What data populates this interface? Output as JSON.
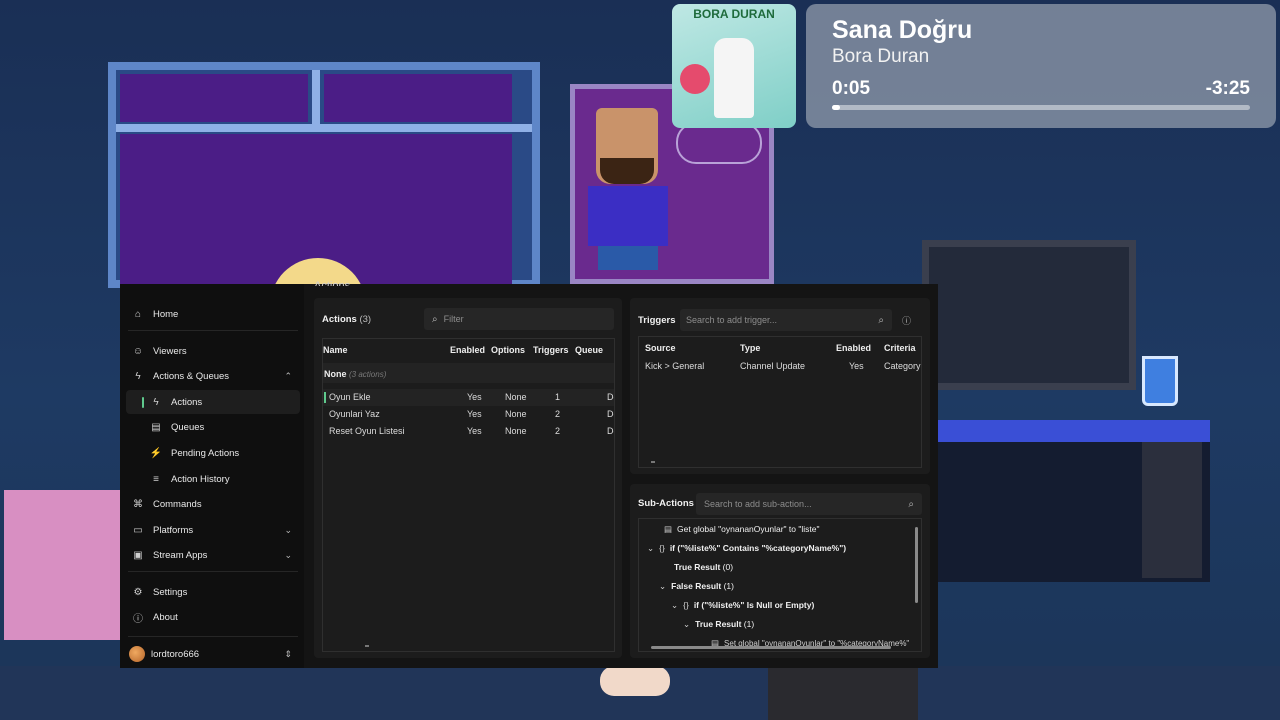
{
  "now_playing": {
    "title": "Sana Doğru",
    "artist": "Bora Duran",
    "elapsed": "0:05",
    "remaining": "-3:25",
    "progress_fraction": 0.02,
    "album_art_text": "BORA DURAN"
  },
  "app": {
    "hidden_header": "Actions",
    "sidebar": {
      "items": [
        {
          "label": "Home",
          "icon": "home-icon"
        },
        {
          "label": "Viewers",
          "icon": "users-icon"
        },
        {
          "label": "Actions & Queues",
          "icon": "bolt-icon"
        },
        {
          "label": "Actions",
          "icon": "bolt-icon"
        },
        {
          "label": "Queues",
          "icon": "queue-icon"
        },
        {
          "label": "Pending Actions",
          "icon": "pending-icon"
        },
        {
          "label": "Action History",
          "icon": "history-icon"
        },
        {
          "label": "Commands",
          "icon": "command-icon"
        },
        {
          "label": "Platforms",
          "icon": "platforms-icon"
        },
        {
          "label": "Stream Apps",
          "icon": "apps-icon"
        },
        {
          "label": "Settings",
          "icon": "gear-icon"
        },
        {
          "label": "About",
          "icon": "info-icon"
        }
      ],
      "user": "lordtoro666"
    },
    "actions": {
      "title": "Actions",
      "count": "(3)",
      "filter_placeholder": "Filter",
      "columns": [
        "Name",
        "Enabled",
        "Options",
        "Triggers",
        "Queue"
      ],
      "group": {
        "label": "None",
        "count": "(3 actions)"
      },
      "rows": [
        {
          "name": "Oyun Ekle",
          "enabled": "Yes",
          "options": "None",
          "triggers": "1",
          "queue": "De"
        },
        {
          "name": "Oyunlari Yaz",
          "enabled": "Yes",
          "options": "None",
          "triggers": "2",
          "queue": "De"
        },
        {
          "name": "Reset Oyun Listesi",
          "enabled": "Yes",
          "options": "None",
          "triggers": "2",
          "queue": "De"
        }
      ]
    },
    "triggers": {
      "title": "Triggers",
      "search_placeholder": "Search to add trigger...",
      "columns": [
        "Source",
        "Type",
        "Enabled",
        "Criteria"
      ],
      "rows": [
        {
          "source": "Kick > General",
          "type": "Channel Update",
          "enabled": "Yes",
          "criteria": "Category"
        }
      ]
    },
    "subactions": {
      "title": "Sub-Actions",
      "search_placeholder": "Search to add sub-action...",
      "lines": [
        "Get global \"oynananOyunlar\" to \"liste\"",
        "if (\"%liste%\" Contains \"%categoryName%\")",
        "True Result",
        "(0)",
        "False Result",
        "(1)",
        "if (\"%liste%\" Is Null or Empty)",
        "True Result",
        "(1)",
        "Set global \"oynananOyunlar\" to \"%categoryName%\""
      ]
    }
  }
}
